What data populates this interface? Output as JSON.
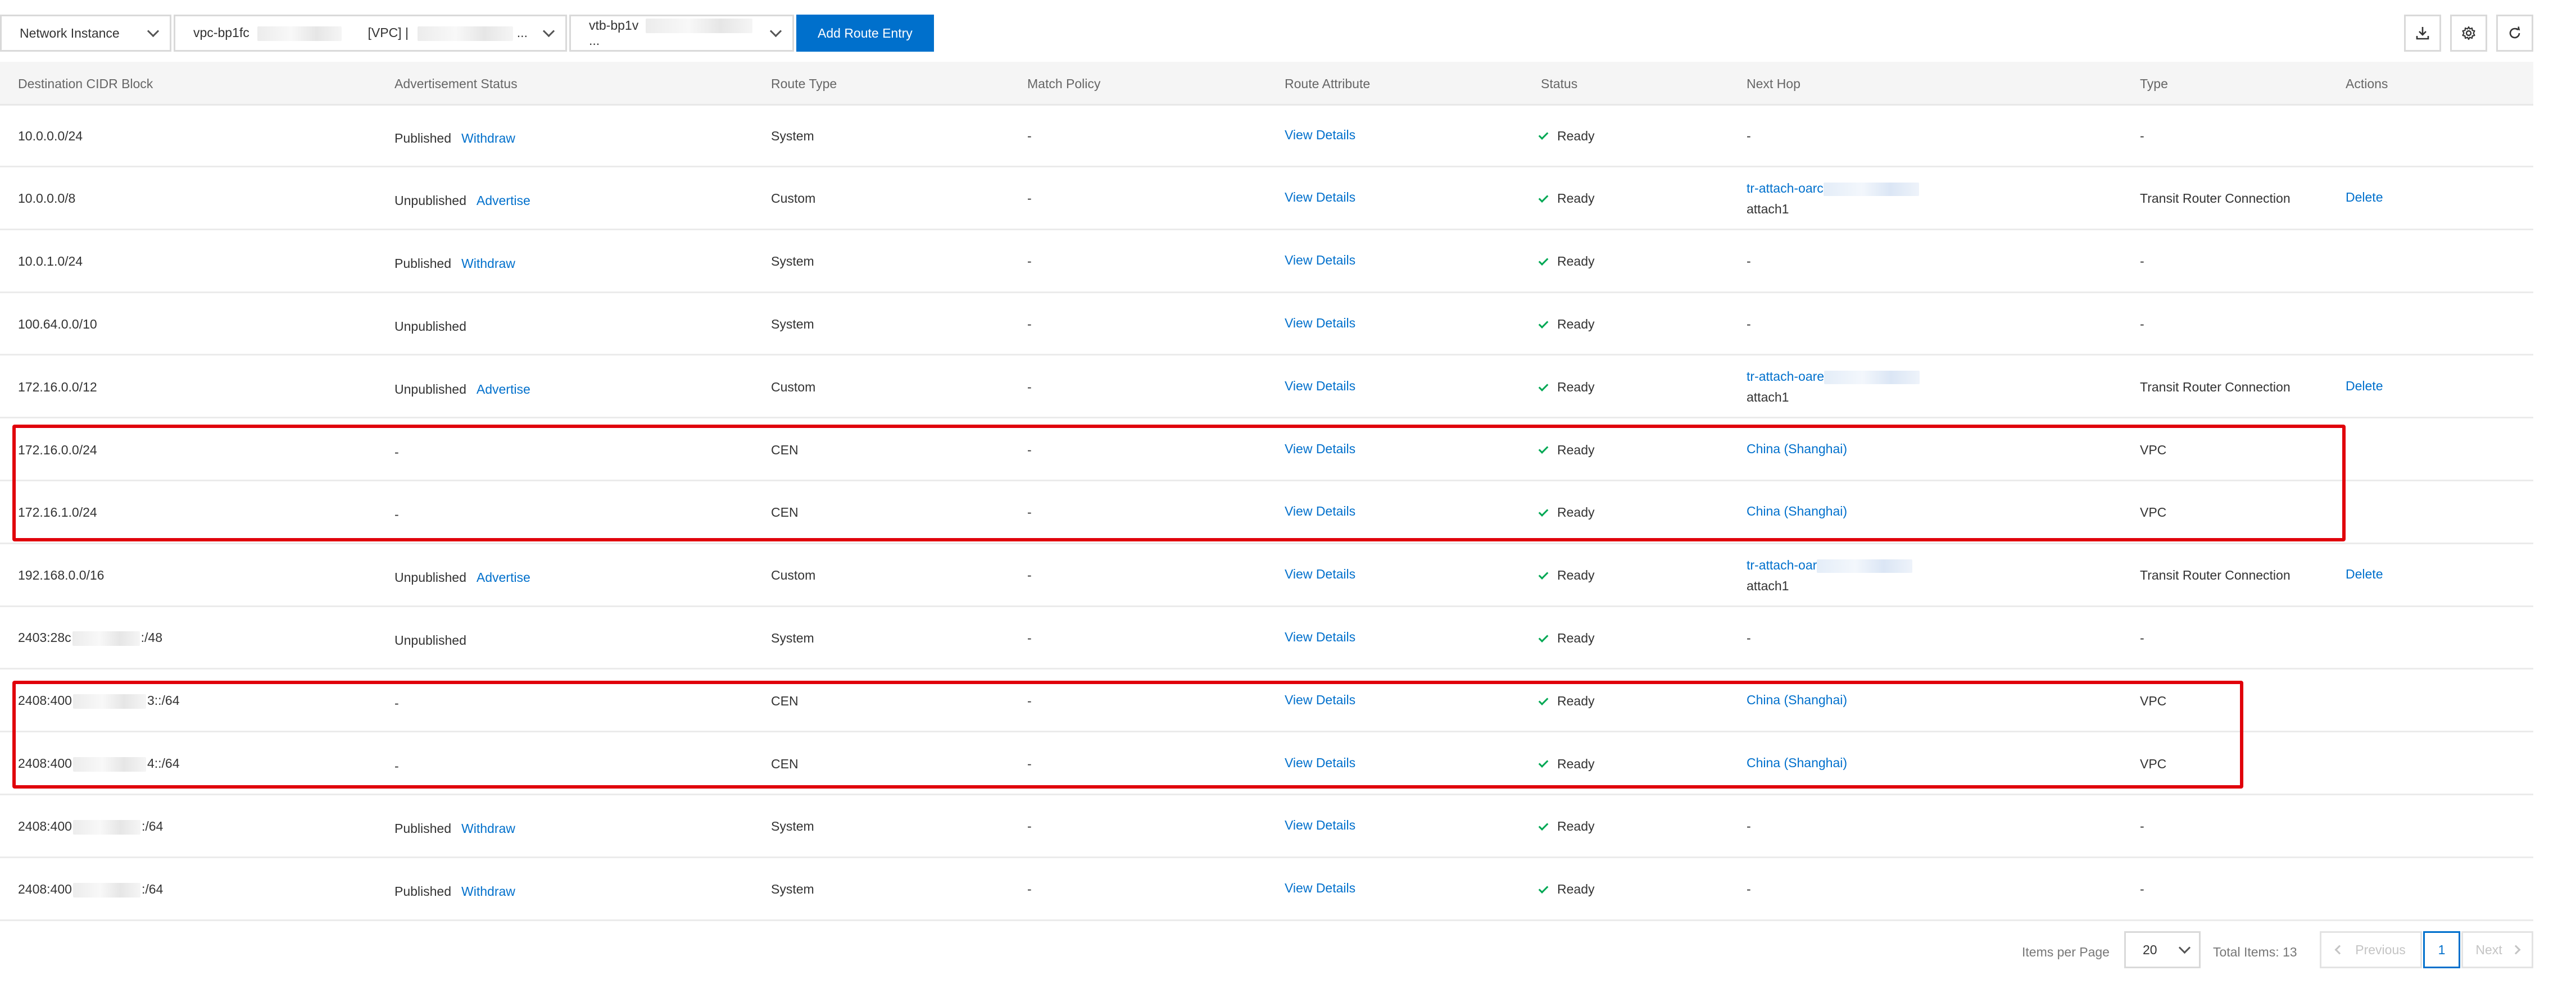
{
  "toolbar": {
    "network_instance_label": "Network Instance",
    "vpc_prefix": "vpc-bp1fc",
    "vpc_type": "[VPC] |",
    "vpc_ellipsis": "...",
    "vtb_prefix": "vtb-bp1v",
    "vtb_ellipsis": "...",
    "add_route_label": "Add Route Entry"
  },
  "columns": {
    "destination": "Destination CIDR Block",
    "advertisement": "Advertisement Status",
    "route_type": "Route Type",
    "match_policy": "Match Policy",
    "route_attribute": "Route Attribute",
    "status": "Status",
    "next_hop": "Next Hop",
    "type": "Type",
    "actions": "Actions"
  },
  "rows": [
    {
      "dest": "10.0.0.0/24",
      "adv": "Published",
      "adv_action": "Withdraw",
      "route_type": "System",
      "match": "-",
      "attr": "View Details",
      "status": "Ready",
      "hop": "-",
      "hop2": "",
      "type": "-",
      "action": ""
    },
    {
      "dest": "10.0.0.0/8",
      "adv": "Unpublished",
      "adv_action": "Advertise",
      "route_type": "Custom",
      "match": "-",
      "attr": "View Details",
      "status": "Ready",
      "hop": "tr-attach-oarc",
      "hop2": "attach1",
      "type": "Transit Router Connection",
      "action": "Delete"
    },
    {
      "dest": "10.0.1.0/24",
      "adv": "Published",
      "adv_action": "Withdraw",
      "route_type": "System",
      "match": "-",
      "attr": "View Details",
      "status": "Ready",
      "hop": "-",
      "hop2": "",
      "type": "-",
      "action": ""
    },
    {
      "dest": "100.64.0.0/10",
      "adv": "Unpublished",
      "adv_action": "",
      "route_type": "System",
      "match": "-",
      "attr": "View Details",
      "status": "Ready",
      "hop": "-",
      "hop2": "",
      "type": "-",
      "action": ""
    },
    {
      "dest": "172.16.0.0/12",
      "adv": "Unpublished",
      "adv_action": "Advertise",
      "route_type": "Custom",
      "match": "-",
      "attr": "View Details",
      "status": "Ready",
      "hop": "tr-attach-oare",
      "hop2": "attach1",
      "type": "Transit Router Connection",
      "action": "Delete"
    },
    {
      "dest": "172.16.0.0/24",
      "adv": "-",
      "adv_action": "",
      "route_type": "CEN",
      "match": "-",
      "attr": "View Details",
      "status": "Ready",
      "hop": "China (Shanghai)",
      "hop2": "",
      "type": "VPC",
      "action": ""
    },
    {
      "dest": "172.16.1.0/24",
      "adv": "-",
      "adv_action": "",
      "route_type": "CEN",
      "match": "-",
      "attr": "View Details",
      "status": "Ready",
      "hop": "China (Shanghai)",
      "hop2": "",
      "type": "VPC",
      "action": ""
    },
    {
      "dest": "192.168.0.0/16",
      "adv": "Unpublished",
      "adv_action": "Advertise",
      "route_type": "Custom",
      "match": "-",
      "attr": "View Details",
      "status": "Ready",
      "hop": "tr-attach-oar",
      "hop2": "attach1",
      "type": "Transit Router Connection",
      "action": "Delete"
    },
    {
      "dest": "2403:28c",
      "dest_suffix": ":/48",
      "adv": "Unpublished",
      "adv_action": "",
      "route_type": "System",
      "match": "-",
      "attr": "View Details",
      "status": "Ready",
      "hop": "-",
      "hop2": "",
      "type": "-",
      "action": ""
    },
    {
      "dest": "2408:400",
      "dest_suffix": "3::/64",
      "adv": "-",
      "adv_action": "",
      "route_type": "CEN",
      "match": "-",
      "attr": "View Details",
      "status": "Ready",
      "hop": "China (Shanghai)",
      "hop2": "",
      "type": "VPC",
      "action": ""
    },
    {
      "dest": "2408:400",
      "dest_suffix": "4::/64",
      "adv": "-",
      "adv_action": "",
      "route_type": "CEN",
      "match": "-",
      "attr": "View Details",
      "status": "Ready",
      "hop": "China (Shanghai)",
      "hop2": "",
      "type": "VPC",
      "action": ""
    },
    {
      "dest": "2408:400",
      "dest_suffix": ":/64",
      "adv": "Published",
      "adv_action": "Withdraw",
      "route_type": "System",
      "match": "-",
      "attr": "View Details",
      "status": "Ready",
      "hop": "-",
      "hop2": "",
      "type": "-",
      "action": ""
    },
    {
      "dest": "2408:400",
      "dest_suffix": ":/64",
      "adv": "Published",
      "adv_action": "Withdraw",
      "route_type": "System",
      "match": "-",
      "attr": "View Details",
      "status": "Ready",
      "hop": "-",
      "hop2": "",
      "type": "-",
      "action": ""
    }
  ],
  "pagination": {
    "items_per_page_label": "Items per Page",
    "items_per_page_value": "20",
    "total_label": "Total Items: 13",
    "previous_label": "Previous",
    "current_page": "1",
    "next_label": "Next"
  },
  "colors": {
    "accent": "#0070cc",
    "highlight": "#e0000b",
    "ready": "#00a854"
  },
  "icons": [
    "download-icon",
    "gear-icon",
    "refresh-icon",
    "checkmark-icon",
    "chevron-down-icon",
    "chevron-left-icon",
    "chevron-right-icon"
  ]
}
